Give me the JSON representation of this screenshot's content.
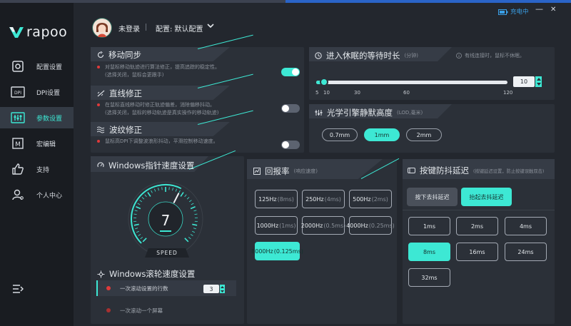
{
  "app": {
    "brand": "rapoo",
    "status": "充电中",
    "window": {
      "minimize": "—",
      "close": "✕"
    },
    "user": "未登录",
    "config": "配置: 默认配置"
  },
  "sidebar": {
    "items": [
      {
        "label": "配置设置",
        "icon": "config-icon",
        "active": false
      },
      {
        "label": "DPI设置",
        "icon": "dpi-icon",
        "active": false
      },
      {
        "label": "参数设置",
        "icon": "params-icon",
        "active": true
      },
      {
        "label": "宏编辑",
        "icon": "macro-icon",
        "active": false
      },
      {
        "label": "支持",
        "icon": "thumbs-up-icon",
        "active": false
      },
      {
        "label": "个人中心",
        "icon": "user-icon",
        "active": false
      }
    ],
    "menu_icon": "menu-icon"
  },
  "motion_sync": {
    "title": "移动同步",
    "desc1": "对鼠标移动轨迹进行算法修正，提高追踪的稳定性。",
    "desc2": "(选择关闭，鼠标会更跟手)",
    "enabled": true
  },
  "angle_snap": {
    "title": "直线修正",
    "desc1": "在鼠标直线移动时修正轨迹偏差，消除偏移抖动。",
    "desc2": "(选择关闭，鼠标的移动轨迹是真实操作的移动轨迹)",
    "enabled": false
  },
  "ripple": {
    "title": "波纹修正",
    "desc1": "鼠标高DPI下调整波浪形抖动，平滑控制移动速度。",
    "enabled": false
  },
  "sleep": {
    "title": "进入休眠的等待时长",
    "unit": "(分钟)",
    "note": "有线连接时，鼠标不休眠。",
    "value": "10",
    "ticks": [
      "5",
      "10",
      "30",
      "60",
      "120"
    ],
    "fraction": 0.04
  },
  "lod": {
    "title": "光学引擎静默高度",
    "unit": "(LOD,毫米)",
    "options": [
      "0.7mm",
      "1mm",
      "2mm"
    ],
    "selected": "1mm"
  },
  "pointer_speed": {
    "title": "Windows指针速度设置",
    "value": "7",
    "gauge_label": "SPEED",
    "fraction": 0.6
  },
  "scroll_speed": {
    "title": "Windows滚轮速度设置",
    "row1": "一次滚动设置的行数",
    "row1_value": "3",
    "row2": "一次滚动一个屏幕",
    "selected_row": 1
  },
  "polling": {
    "title": "回报率",
    "unit": "(响应速度)",
    "options": [
      {
        "main": "125Hz",
        "sub": "(8ms)"
      },
      {
        "main": "250Hz",
        "sub": "(4ms)"
      },
      {
        "main": "500Hz",
        "sub": "(2ms)"
      },
      {
        "main": "1000Hz",
        "sub": "(1ms)"
      },
      {
        "main": "2000Hz",
        "sub": "(0.5ms)"
      },
      {
        "main": "4000Hz",
        "sub": "(0.25ms)"
      },
      {
        "main": "8000Hz",
        "sub": "(0.125ms)"
      }
    ],
    "selected": 6
  },
  "debounce": {
    "title": "按键防抖延迟",
    "unit": "(按键延迟设置，防止按键误触双击)",
    "mode_press": "按下去抖延迟",
    "mode_release": "抬起去抖延迟",
    "active_mode": "release",
    "options": [
      "1ms",
      "2ms",
      "4ms",
      "8ms",
      "16ms",
      "24ms",
      "32ms"
    ],
    "selected": 3
  },
  "colors": {
    "accent": "#3de8d4",
    "danger": "#e03a3a",
    "panel": "#2b3038"
  }
}
